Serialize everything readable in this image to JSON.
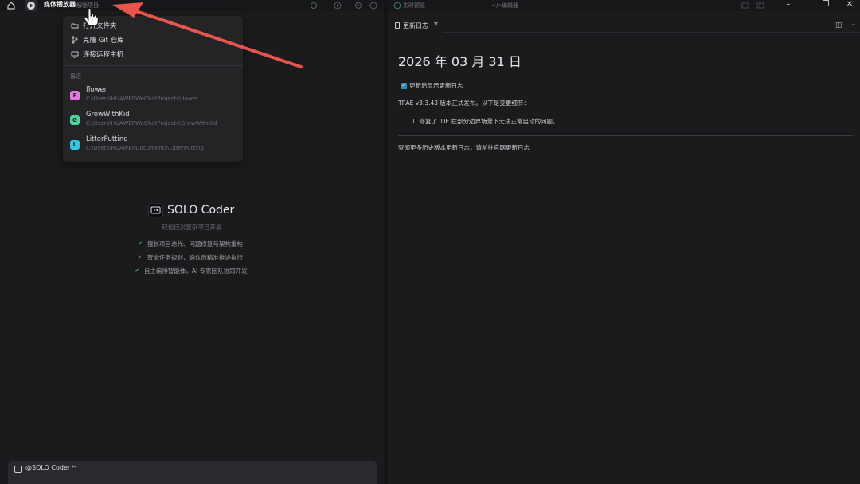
{
  "topbar": {
    "app_title": "媒体播放器",
    "project_dropdown": "解锁项目",
    "right_tabs": [
      "实时预览",
      "编辑器"
    ]
  },
  "dropdown": {
    "items": [
      {
        "label": "打开文件夹",
        "icon": "folder-open-icon"
      },
      {
        "label": "克隆 Git 仓库",
        "icon": "git-branch-icon"
      },
      {
        "label": "连接远程主机",
        "icon": "remote-host-icon"
      }
    ],
    "recent_label": "最近",
    "recent": [
      {
        "name": "flower",
        "path": "C:\\Users\\HUAWEI\\WeChatProjects\\flower",
        "badge": "F",
        "color": "#e07be0"
      },
      {
        "name": "GrowWithKid",
        "path": "C:\\Users\\HUAWEI\\WeChatProjects\\GrowWithKid",
        "badge": "G",
        "color": "#4ed19a"
      },
      {
        "name": "LitterPutting",
        "path": "C:\\Users\\HUAWEI\\Documents\\LitterPutting",
        "badge": "L",
        "color": "#35c6e0"
      }
    ]
  },
  "solo": {
    "title": "SOLO Coder",
    "subtitle": "轻松应对复杂项目开发",
    "features": [
      "擅长项目迭代、问题修复与架构重构",
      "智能任务规划，确认后精准推进执行",
      "自主编排智能体，AI 专家团队协同开发"
    ]
  },
  "chat": {
    "label": "@SOLO Coder"
  },
  "editor": {
    "tab_label": "更新日志",
    "heading": "2026 年 03 月 31 日",
    "checkbox_label": "更新后显示更新日志",
    "release_line": "TRAE v3.3.43 版本正式发布。以下是变更细节：",
    "item_1": "1. 修复了 IDE 在部分边界场景下无法正常启动的问题。",
    "footer_line": "查阅更多历史版本更新日志，请前往官网更新日志"
  },
  "colors": {
    "accent_check": "#2a8fb8",
    "arrow": "#e8544e",
    "feature_check": "#3bb08f"
  }
}
